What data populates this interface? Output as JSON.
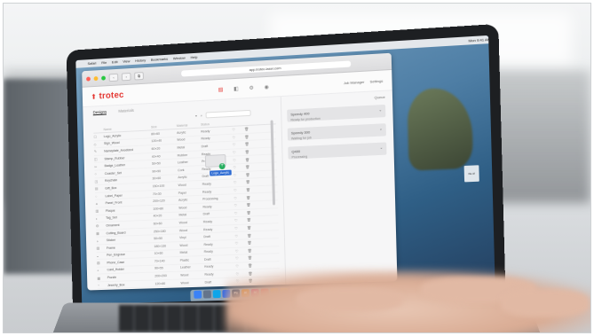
{
  "colors": {
    "brand": "#e3342f",
    "accent_blue": "#2d6bd3",
    "success": "#27ae60"
  },
  "menubar": {
    "items": [
      "Safari",
      "File",
      "Edit",
      "View",
      "History",
      "Bookmarks",
      "Window",
      "Help"
    ],
    "clock": "Mon 9:41 AM"
  },
  "browser": {
    "address": "app.trotec-laser.com",
    "buttons": [
      "‹",
      "›",
      "⧉"
    ]
  },
  "app": {
    "logo": "trotec",
    "nav_icons": [
      "list-icon",
      "layers-icon",
      "settings-icon",
      "user-icon"
    ],
    "header_right": [
      "Job Manager",
      "Settings"
    ]
  },
  "list": {
    "tabs": [
      "Designs",
      "Materials"
    ],
    "search_label": "Search",
    "columns": [
      "",
      "Name",
      "Size",
      "Material",
      "Status",
      "",
      ""
    ],
    "rows": [
      {
        "name": "Logo_Acrylic",
        "size": "80×60",
        "material": "Acrylic",
        "status": "Ready"
      },
      {
        "name": "Sign_Wood",
        "size": "120×40",
        "material": "Wood",
        "status": "Ready"
      },
      {
        "name": "Nameplate_Anodized",
        "size": "60×20",
        "material": "Metal",
        "status": "Draft"
      },
      {
        "name": "Stamp_Rubber",
        "size": "40×40",
        "material": "Rubber",
        "status": "Ready"
      },
      {
        "name": "Badge_Leather",
        "size": "50×50",
        "material": "Leather",
        "status": "Processing"
      },
      {
        "name": "Coaster_Set",
        "size": "90×90",
        "material": "Cork",
        "status": "Ready"
      },
      {
        "name": "Keychain",
        "size": "30×60",
        "material": "Acrylic",
        "status": "Draft"
      },
      {
        "name": "Gift_Box",
        "size": "150×100",
        "material": "Wood",
        "status": "Ready"
      },
      {
        "name": "Label_Paper",
        "size": "70×30",
        "material": "Paper",
        "status": "Ready"
      },
      {
        "name": "Panel_Front",
        "size": "200×120",
        "material": "Acrylic",
        "status": "Processing"
      },
      {
        "name": "Plaque",
        "size": "100×80",
        "material": "Wood",
        "status": "Ready"
      },
      {
        "name": "Tag_Set",
        "size": "40×20",
        "material": "Metal",
        "status": "Draft"
      },
      {
        "name": "Ornament",
        "size": "60×60",
        "material": "Wood",
        "status": "Ready"
      },
      {
        "name": "Cutting_Board",
        "size": "250×180",
        "material": "Wood",
        "status": "Ready"
      },
      {
        "name": "Sticker",
        "size": "50×50",
        "material": "Vinyl",
        "status": "Draft"
      },
      {
        "name": "Frame",
        "size": "180×130",
        "material": "Wood",
        "status": "Ready"
      },
      {
        "name": "Pen_Engrave",
        "size": "10×60",
        "material": "Metal",
        "status": "Ready"
      },
      {
        "name": "Phone_Case",
        "size": "70×140",
        "material": "Plastic",
        "status": "Draft"
      },
      {
        "name": "Card_Holder",
        "size": "90×55",
        "material": "Leather",
        "status": "Ready"
      },
      {
        "name": "Puzzle",
        "size": "200×200",
        "material": "Wood",
        "status": "Ready"
      },
      {
        "name": "Jewelry_Box",
        "size": "120×80",
        "material": "Wood",
        "status": "Draft"
      }
    ]
  },
  "drag": {
    "label": "Logo_Acrylic"
  },
  "panel": {
    "top_label": "Queue",
    "cards": [
      {
        "title": "Speedy 400",
        "sub": "Ready for production"
      },
      {
        "title": "Speedy 300",
        "sub": "Waiting for job"
      },
      {
        "title": "Q400",
        "sub": "Processing"
      }
    ]
  },
  "desktop": {
    "file_label": "file.tif"
  },
  "dock": {
    "apps": [
      {
        "name": "finder-icon",
        "label": "",
        "color": "#3b82f6"
      },
      {
        "name": "launchpad-icon",
        "label": "",
        "color": "#64748b"
      },
      {
        "name": "safari-icon",
        "label": "",
        "color": "#0ea5e9"
      },
      {
        "name": "mail-icon",
        "label": "",
        "color": "#2563eb"
      },
      {
        "name": "photoshop-icon",
        "label": "Ps",
        "color": "#0b2b57"
      },
      {
        "name": "illustrator-icon",
        "label": "Ai",
        "color": "#d97706"
      },
      {
        "name": "indesign-icon",
        "label": "Id",
        "color": "#be185d"
      },
      {
        "name": "acrobat-icon",
        "label": "",
        "color": "#dc2626"
      },
      {
        "name": "chrome-icon",
        "label": "",
        "color": "#f59e0b"
      },
      {
        "name": "notes-icon",
        "label": "",
        "color": "#facc15"
      },
      {
        "name": "calendar-icon",
        "label": "",
        "color": "#f3f4f6"
      },
      {
        "name": "settings-icon",
        "label": "",
        "color": "#9ca3af"
      },
      {
        "name": "trash-icon",
        "label": "",
        "color": "#d1d5db"
      }
    ]
  }
}
